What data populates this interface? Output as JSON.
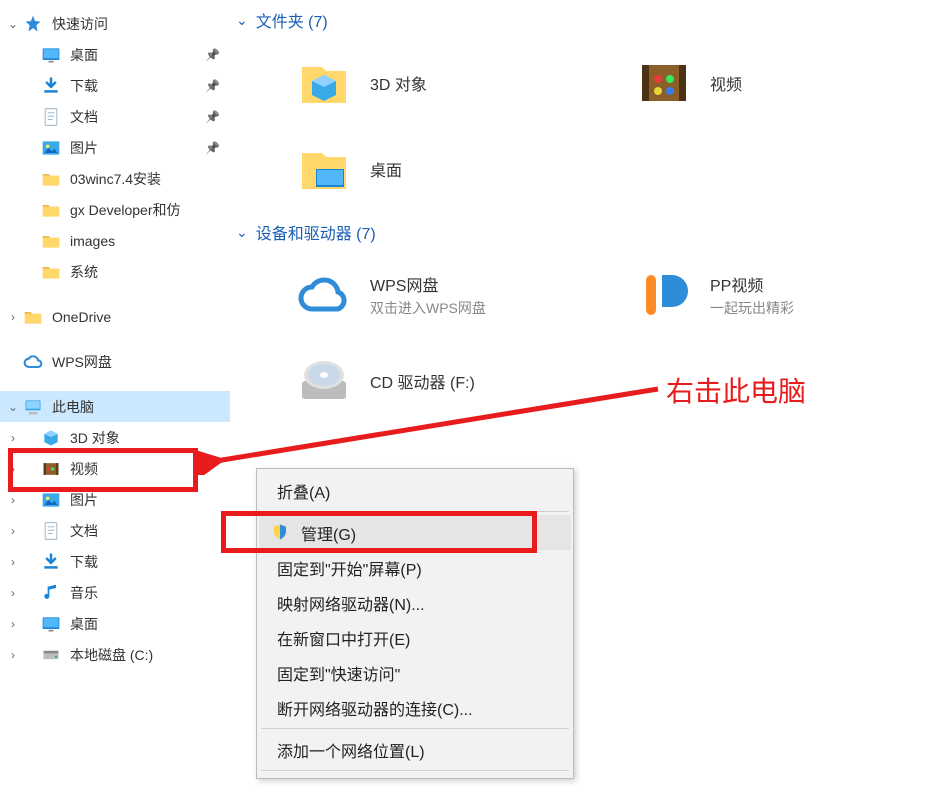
{
  "sidebar": {
    "items": [
      {
        "label": "快速访问",
        "chevron": "down",
        "indent": 0,
        "icon": "star",
        "pinned": false
      },
      {
        "label": "桌面",
        "chevron": "",
        "indent": 1,
        "icon": "desktop",
        "pinned": true
      },
      {
        "label": "下载",
        "chevron": "",
        "indent": 1,
        "icon": "download",
        "pinned": true
      },
      {
        "label": "文档",
        "chevron": "",
        "indent": 1,
        "icon": "doc",
        "pinned": true
      },
      {
        "label": "图片",
        "chevron": "",
        "indent": 1,
        "icon": "pictures",
        "pinned": true
      },
      {
        "label": "03winc7.4安装",
        "chevron": "",
        "indent": 1,
        "icon": "folder",
        "pinned": false
      },
      {
        "label": "gx Developer和仿",
        "chevron": "",
        "indent": 1,
        "icon": "folder",
        "pinned": false
      },
      {
        "label": "images",
        "chevron": "",
        "indent": 1,
        "icon": "folder",
        "pinned": false
      },
      {
        "label": "系统",
        "chevron": "",
        "indent": 1,
        "icon": "folder",
        "pinned": false
      },
      {
        "label": "OneDrive",
        "chevron": "right",
        "indent": 0,
        "icon": "folder",
        "pinned": false,
        "gapTop": true
      },
      {
        "label": "WPS网盘",
        "chevron": "",
        "indent": 0,
        "icon": "cloud",
        "pinned": false,
        "gapTop": true
      },
      {
        "label": "此电脑",
        "chevron": "down",
        "indent": 0,
        "icon": "pc",
        "pinned": false,
        "selected": true,
        "gapTop": true
      },
      {
        "label": "3D 对象",
        "chevron": "right",
        "indent": 1,
        "icon": "3d",
        "pinned": false
      },
      {
        "label": "视频",
        "chevron": "right",
        "indent": 1,
        "icon": "video",
        "pinned": false
      },
      {
        "label": "图片",
        "chevron": "right",
        "indent": 1,
        "icon": "pictures",
        "pinned": false
      },
      {
        "label": "文档",
        "chevron": "right",
        "indent": 1,
        "icon": "doc",
        "pinned": false
      },
      {
        "label": "下载",
        "chevron": "right",
        "indent": 1,
        "icon": "download",
        "pinned": false
      },
      {
        "label": "音乐",
        "chevron": "right",
        "indent": 1,
        "icon": "music",
        "pinned": false
      },
      {
        "label": "桌面",
        "chevron": "right",
        "indent": 1,
        "icon": "desktop",
        "pinned": false
      },
      {
        "label": "本地磁盘 (C:)",
        "chevron": "right",
        "indent": 1,
        "icon": "disk",
        "pinned": false
      }
    ]
  },
  "main": {
    "section1": {
      "label": "文件夹 (7)"
    },
    "folders": [
      {
        "title": "3D 对象",
        "icon": "3d-big"
      },
      {
        "title": "视频",
        "icon": "video-big"
      },
      {
        "title": "桌面",
        "icon": "desktop-big"
      }
    ],
    "section2": {
      "label": "设备和驱动器 (7)"
    },
    "devices": [
      {
        "title": "WPS网盘",
        "subtitle": "双击进入WPS网盘",
        "icon": "cloud-big"
      },
      {
        "title": "PP视频",
        "subtitle": "一起玩出精彩",
        "icon": "pp-big"
      },
      {
        "title": "CD 驱动器 (F:)",
        "subtitle": "",
        "icon": "cd-big"
      }
    ]
  },
  "context_menu": {
    "items": [
      {
        "label": "折叠(A)",
        "type": "item"
      },
      {
        "type": "sep"
      },
      {
        "label": "管理(G)",
        "type": "item",
        "shield": true,
        "highlight": true
      },
      {
        "label": "固定到\"开始\"屏幕(P)",
        "type": "item"
      },
      {
        "label": "映射网络驱动器(N)...",
        "type": "item"
      },
      {
        "label": "在新窗口中打开(E)",
        "type": "item"
      },
      {
        "label": "固定到\"快速访问\"",
        "type": "item"
      },
      {
        "label": "断开网络驱动器的连接(C)...",
        "type": "item"
      },
      {
        "type": "sep"
      },
      {
        "label": "添加一个网络位置(L)",
        "type": "item"
      },
      {
        "type": "sep"
      }
    ]
  },
  "annotation": {
    "text": "右击此电脑"
  },
  "colors": {
    "highlight": "#e81c1c",
    "link": "#1a5fb4"
  }
}
